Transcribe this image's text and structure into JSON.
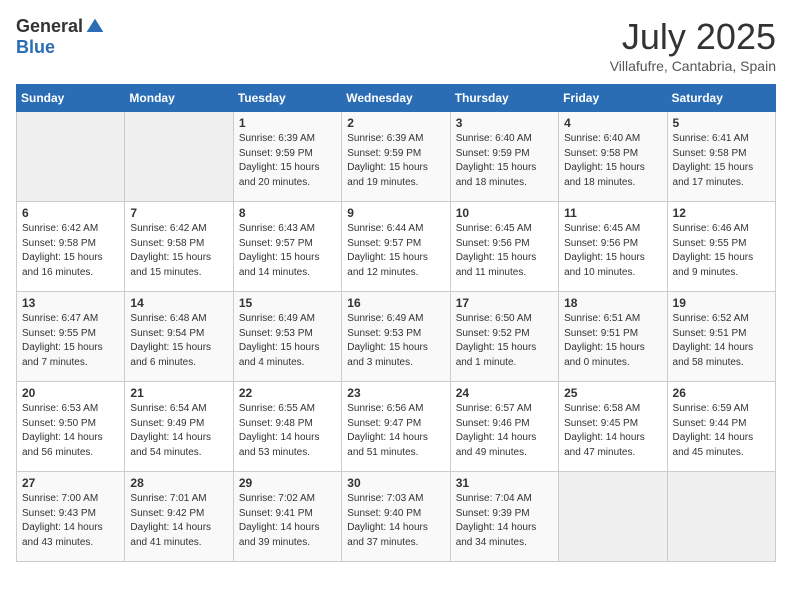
{
  "header": {
    "logo_general": "General",
    "logo_blue": "Blue",
    "month_year": "July 2025",
    "location": "Villafufre, Cantabria, Spain"
  },
  "days_of_week": [
    "Sunday",
    "Monday",
    "Tuesday",
    "Wednesday",
    "Thursday",
    "Friday",
    "Saturday"
  ],
  "weeks": [
    [
      {
        "day": "",
        "sunrise": "",
        "sunset": "",
        "daylight": ""
      },
      {
        "day": "",
        "sunrise": "",
        "sunset": "",
        "daylight": ""
      },
      {
        "day": "1",
        "sunrise": "Sunrise: 6:39 AM",
        "sunset": "Sunset: 9:59 PM",
        "daylight": "Daylight: 15 hours and 20 minutes."
      },
      {
        "day": "2",
        "sunrise": "Sunrise: 6:39 AM",
        "sunset": "Sunset: 9:59 PM",
        "daylight": "Daylight: 15 hours and 19 minutes."
      },
      {
        "day": "3",
        "sunrise": "Sunrise: 6:40 AM",
        "sunset": "Sunset: 9:59 PM",
        "daylight": "Daylight: 15 hours and 18 minutes."
      },
      {
        "day": "4",
        "sunrise": "Sunrise: 6:40 AM",
        "sunset": "Sunset: 9:58 PM",
        "daylight": "Daylight: 15 hours and 18 minutes."
      },
      {
        "day": "5",
        "sunrise": "Sunrise: 6:41 AM",
        "sunset": "Sunset: 9:58 PM",
        "daylight": "Daylight: 15 hours and 17 minutes."
      }
    ],
    [
      {
        "day": "6",
        "sunrise": "Sunrise: 6:42 AM",
        "sunset": "Sunset: 9:58 PM",
        "daylight": "Daylight: 15 hours and 16 minutes."
      },
      {
        "day": "7",
        "sunrise": "Sunrise: 6:42 AM",
        "sunset": "Sunset: 9:58 PM",
        "daylight": "Daylight: 15 hours and 15 minutes."
      },
      {
        "day": "8",
        "sunrise": "Sunrise: 6:43 AM",
        "sunset": "Sunset: 9:57 PM",
        "daylight": "Daylight: 15 hours and 14 minutes."
      },
      {
        "day": "9",
        "sunrise": "Sunrise: 6:44 AM",
        "sunset": "Sunset: 9:57 PM",
        "daylight": "Daylight: 15 hours and 12 minutes."
      },
      {
        "day": "10",
        "sunrise": "Sunrise: 6:45 AM",
        "sunset": "Sunset: 9:56 PM",
        "daylight": "Daylight: 15 hours and 11 minutes."
      },
      {
        "day": "11",
        "sunrise": "Sunrise: 6:45 AM",
        "sunset": "Sunset: 9:56 PM",
        "daylight": "Daylight: 15 hours and 10 minutes."
      },
      {
        "day": "12",
        "sunrise": "Sunrise: 6:46 AM",
        "sunset": "Sunset: 9:55 PM",
        "daylight": "Daylight: 15 hours and 9 minutes."
      }
    ],
    [
      {
        "day": "13",
        "sunrise": "Sunrise: 6:47 AM",
        "sunset": "Sunset: 9:55 PM",
        "daylight": "Daylight: 15 hours and 7 minutes."
      },
      {
        "day": "14",
        "sunrise": "Sunrise: 6:48 AM",
        "sunset": "Sunset: 9:54 PM",
        "daylight": "Daylight: 15 hours and 6 minutes."
      },
      {
        "day": "15",
        "sunrise": "Sunrise: 6:49 AM",
        "sunset": "Sunset: 9:53 PM",
        "daylight": "Daylight: 15 hours and 4 minutes."
      },
      {
        "day": "16",
        "sunrise": "Sunrise: 6:49 AM",
        "sunset": "Sunset: 9:53 PM",
        "daylight": "Daylight: 15 hours and 3 minutes."
      },
      {
        "day": "17",
        "sunrise": "Sunrise: 6:50 AM",
        "sunset": "Sunset: 9:52 PM",
        "daylight": "Daylight: 15 hours and 1 minute."
      },
      {
        "day": "18",
        "sunrise": "Sunrise: 6:51 AM",
        "sunset": "Sunset: 9:51 PM",
        "daylight": "Daylight: 15 hours and 0 minutes."
      },
      {
        "day": "19",
        "sunrise": "Sunrise: 6:52 AM",
        "sunset": "Sunset: 9:51 PM",
        "daylight": "Daylight: 14 hours and 58 minutes."
      }
    ],
    [
      {
        "day": "20",
        "sunrise": "Sunrise: 6:53 AM",
        "sunset": "Sunset: 9:50 PM",
        "daylight": "Daylight: 14 hours and 56 minutes."
      },
      {
        "day": "21",
        "sunrise": "Sunrise: 6:54 AM",
        "sunset": "Sunset: 9:49 PM",
        "daylight": "Daylight: 14 hours and 54 minutes."
      },
      {
        "day": "22",
        "sunrise": "Sunrise: 6:55 AM",
        "sunset": "Sunset: 9:48 PM",
        "daylight": "Daylight: 14 hours and 53 minutes."
      },
      {
        "day": "23",
        "sunrise": "Sunrise: 6:56 AM",
        "sunset": "Sunset: 9:47 PM",
        "daylight": "Daylight: 14 hours and 51 minutes."
      },
      {
        "day": "24",
        "sunrise": "Sunrise: 6:57 AM",
        "sunset": "Sunset: 9:46 PM",
        "daylight": "Daylight: 14 hours and 49 minutes."
      },
      {
        "day": "25",
        "sunrise": "Sunrise: 6:58 AM",
        "sunset": "Sunset: 9:45 PM",
        "daylight": "Daylight: 14 hours and 47 minutes."
      },
      {
        "day": "26",
        "sunrise": "Sunrise: 6:59 AM",
        "sunset": "Sunset: 9:44 PM",
        "daylight": "Daylight: 14 hours and 45 minutes."
      }
    ],
    [
      {
        "day": "27",
        "sunrise": "Sunrise: 7:00 AM",
        "sunset": "Sunset: 9:43 PM",
        "daylight": "Daylight: 14 hours and 43 minutes."
      },
      {
        "day": "28",
        "sunrise": "Sunrise: 7:01 AM",
        "sunset": "Sunset: 9:42 PM",
        "daylight": "Daylight: 14 hours and 41 minutes."
      },
      {
        "day": "29",
        "sunrise": "Sunrise: 7:02 AM",
        "sunset": "Sunset: 9:41 PM",
        "daylight": "Daylight: 14 hours and 39 minutes."
      },
      {
        "day": "30",
        "sunrise": "Sunrise: 7:03 AM",
        "sunset": "Sunset: 9:40 PM",
        "daylight": "Daylight: 14 hours and 37 minutes."
      },
      {
        "day": "31",
        "sunrise": "Sunrise: 7:04 AM",
        "sunset": "Sunset: 9:39 PM",
        "daylight": "Daylight: 14 hours and 34 minutes."
      },
      {
        "day": "",
        "sunrise": "",
        "sunset": "",
        "daylight": ""
      },
      {
        "day": "",
        "sunrise": "",
        "sunset": "",
        "daylight": ""
      }
    ]
  ]
}
